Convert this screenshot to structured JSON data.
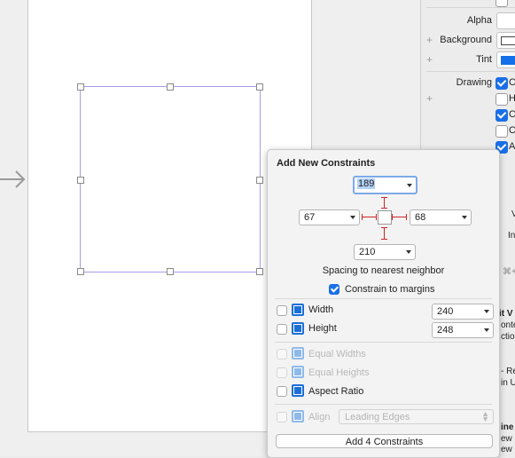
{
  "inspector": {
    "alpha_label": "Alpha",
    "background_label": "Background",
    "tint_label": "Tint",
    "drawing_label": "Drawing",
    "drawing_options": [
      {
        "label": "C",
        "checked": true
      },
      {
        "label": "H",
        "checked": false
      },
      {
        "label": "C",
        "checked": true
      },
      {
        "label": "C",
        "checked": false
      },
      {
        "label": "A",
        "checked": true
      }
    ],
    "fragments": [
      "V",
      "In",
      "⌘+",
      "it V",
      "onte",
      "ction",
      "- Re",
      "in U",
      "ine",
      "ew -",
      "ew -"
    ],
    "tint_color": "#1370e8"
  },
  "popover": {
    "title": "Add New Constraints",
    "top": "189",
    "left": "67",
    "right": "68",
    "bottom": "210",
    "spacing_label": "Spacing to nearest neighbor",
    "constrain_label": "Constrain to margins",
    "constrain_checked": true,
    "width_label": "Width",
    "width_value": "240",
    "height_label": "Height",
    "height_value": "248",
    "equal_widths": "Equal Widths",
    "equal_heights": "Equal Heights",
    "aspect_ratio": "Aspect Ratio",
    "align_label": "Align",
    "align_value": "Leading Edges",
    "add_button": "Add 4 Constraints"
  }
}
